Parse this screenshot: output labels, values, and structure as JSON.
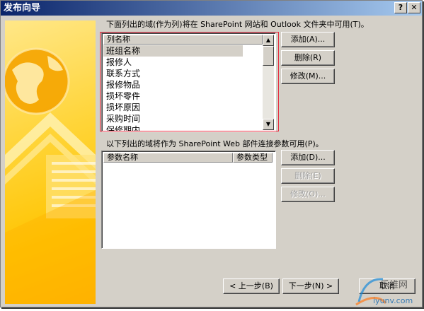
{
  "window": {
    "title": "发布向导",
    "help_label": "?",
    "close_label": "✕"
  },
  "fields_section": {
    "label": "下面列出的域(作为列)将在 SharePoint 网站和 Outlook 文件夹中可用(T)。",
    "column_header": "列名称",
    "items": [
      "班组名称",
      "报修人",
      "联系方式",
      "报修物品",
      "损坏零件",
      "损坏原因",
      "采购时间",
      "保修期内"
    ],
    "selected_index": 0,
    "buttons": {
      "add": "添加(A)...",
      "delete": "删除(R)",
      "modify": "修改(M)..."
    }
  },
  "params_section": {
    "label": "以下列出的域将作为 SharePoint Web 部件连接参数可用(P)。",
    "column_headers": [
      "参数名称",
      "参数类型"
    ],
    "rows": [],
    "buttons": {
      "add": "添加(D)...",
      "delete": "删除(E)",
      "modify": "修改(O)..."
    }
  },
  "footer": {
    "back": "< 上一步(B)",
    "next": "下一步(N) >",
    "cancel": "取消"
  },
  "watermark": {
    "cn": "乐维网",
    "url": "iyunv.com"
  },
  "icons": {
    "up": "up-arrow-icon",
    "down": "down-arrow-icon",
    "globe": "globe-icon"
  },
  "colors": {
    "dialog": "#d4d0c8",
    "title_start": "#0a246a",
    "title_end": "#a6caf0",
    "highlight": "#e8283c",
    "art": "#ffc400"
  }
}
